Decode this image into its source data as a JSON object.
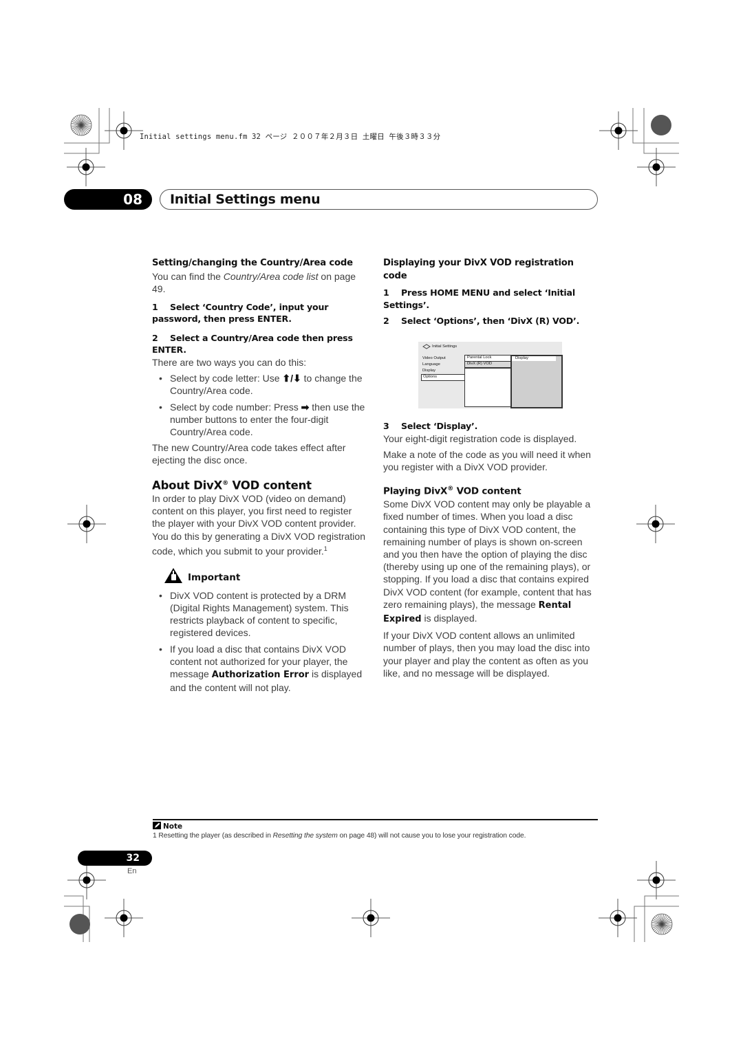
{
  "print_header": "Initial settings menu.fm  32 ページ  ２００７年２月３日  土曜日  午後３時３３分",
  "chapter": {
    "number": "08",
    "title": "Initial Settings menu"
  },
  "left_column": {
    "section1_title": "Setting/changing the Country/Area code",
    "section1_intro_pre": "You can find the ",
    "section1_intro_italic": "Country/Area code list",
    "section1_intro_post": " on page 49.",
    "step1_num": "1",
    "step1_text": "Select ‘Country Code’, input your password, then press ENTER.",
    "step2_num": "2",
    "step2_text": "Select a Country/Area code then press ENTER.",
    "step2_body": "There are two ways you can do this:",
    "bullets": [
      {
        "pre": "Select by code letter: Use ",
        "glyph": "⬆/⬇",
        "post": " to change the Country/Area code."
      },
      {
        "pre": "Select by code number: Press ",
        "glyph": "➡",
        "post": " then use the number buttons to enter the four-digit Country/Area code."
      }
    ],
    "after_bullets": "The new Country/Area code takes effect after ejecting the disc once.",
    "section2_title_pre": "About DivX",
    "section2_title_sup": "®",
    "section2_title_post": " VOD content",
    "section2_body": "In order to play DivX VOD (video on demand) content on this player, you first need to register the player with your DivX VOD content provider. You do this by generating a DivX VOD registration code, which you submit to your provider.",
    "section2_footnote_ref": "1",
    "important_label": "Important",
    "important_bullets": [
      {
        "pre": "DivX VOD content is protected by a DRM (Digital Rights Management) system. This restricts playback of content to specific, registered devices.",
        "bold": "",
        "post": ""
      },
      {
        "pre": "If you load a disc that contains DivX VOD content not authorized for your player, the message ",
        "bold": "Authorization Error",
        "post": " is displayed and the content will not play."
      }
    ]
  },
  "right_column": {
    "section_title": "Displaying your DivX VOD registration code",
    "step1_num": "1",
    "step1_text": "Press HOME MENU and select ‘Initial Settings’.",
    "step2_num": "2",
    "step2_text": "Select ‘Options’, then ‘DivX (R) VOD’.",
    "menu_screenshot": {
      "title": "Initial Settings",
      "left_items": [
        "Video Output",
        "Language",
        "Display",
        "Options"
      ],
      "selected_left": "Options",
      "middle_items": [
        "Parental Lock",
        "DivX (R) VOD"
      ],
      "selected_middle": "DivX (R) VOD",
      "right_items": [
        "Display"
      ]
    },
    "step3_num": "3",
    "step3_text": "Select ‘Display’.",
    "step3_body1": "Your eight-digit registration code is displayed.",
    "step3_body2": "Make a note of the code as you will need it when you register with a DivX VOD provider.",
    "section2_title_pre": "Playing DivX",
    "section2_title_sup": "®",
    "section2_title_post": " VOD content",
    "section2_body1_pre": "Some DivX VOD content may only be playable a fixed number of times. When you load a disc containing this type of DivX VOD content, the remaining number of plays is shown on-screen and you then have the option of playing the disc (thereby using up one of the remaining plays), or stopping. If you load a disc that contains expired DivX VOD content (for example, content that has zero remaining plays), the message ",
    "section2_body1_bold": "Rental Expired",
    "section2_body1_post": " is displayed.",
    "section2_body2": "If your DivX VOD content allows an unlimited number of plays, then you may load the disc into your player and play the content as often as you like, and no message will be displayed."
  },
  "note": {
    "label": "Note",
    "num": "1",
    "pre": " Resetting the player (as described in ",
    "italic": "Resetting the system",
    "post": " on page 48) will not cause you to lose your registration code."
  },
  "page": {
    "number": "32",
    "language": "En"
  }
}
